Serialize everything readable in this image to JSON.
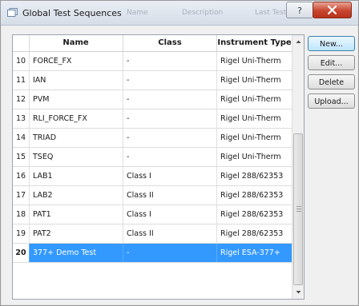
{
  "window": {
    "title": "Global Test Sequences"
  },
  "ghost_headers": [
    "Name",
    "Description",
    "Last Test"
  ],
  "columns": {
    "number": "",
    "name": "Name",
    "class": "Class",
    "instrument": "Instrument Type"
  },
  "rows": [
    {
      "num": "10",
      "name": "FORCE_FX",
      "class": "-",
      "instrument": "Rigel Uni-Therm"
    },
    {
      "num": "11",
      "name": "IAN",
      "class": "-",
      "instrument": "Rigel Uni-Therm"
    },
    {
      "num": "12",
      "name": "PVM",
      "class": "-",
      "instrument": "Rigel Uni-Therm"
    },
    {
      "num": "13",
      "name": "RLI_FORCE_FX",
      "class": "-",
      "instrument": "Rigel Uni-Therm"
    },
    {
      "num": "14",
      "name": "TRIAD",
      "class": "-",
      "instrument": "Rigel Uni-Therm"
    },
    {
      "num": "15",
      "name": "TSEQ",
      "class": "-",
      "instrument": "Rigel Uni-Therm"
    },
    {
      "num": "16",
      "name": "LAB1",
      "class": "Class I",
      "instrument": "Rigel 288/62353"
    },
    {
      "num": "17",
      "name": "LAB2",
      "class": "Class II",
      "instrument": "Rigel 288/62353"
    },
    {
      "num": "18",
      "name": "PAT1",
      "class": "Class I",
      "instrument": "Rigel 288/62353"
    },
    {
      "num": "19",
      "name": "PAT2",
      "class": "Class II",
      "instrument": "Rigel 288/62353"
    },
    {
      "num": "20",
      "name": "377+ Demo Test",
      "class": "-",
      "instrument": "Rigel ESA-377+"
    }
  ],
  "selected_row": "20",
  "buttons": {
    "new": "New...",
    "edit": "Edit...",
    "delete": "Delete",
    "upload": "Upload..."
  },
  "colors": {
    "selection": "#3399ff",
    "close": "#c8452e"
  }
}
